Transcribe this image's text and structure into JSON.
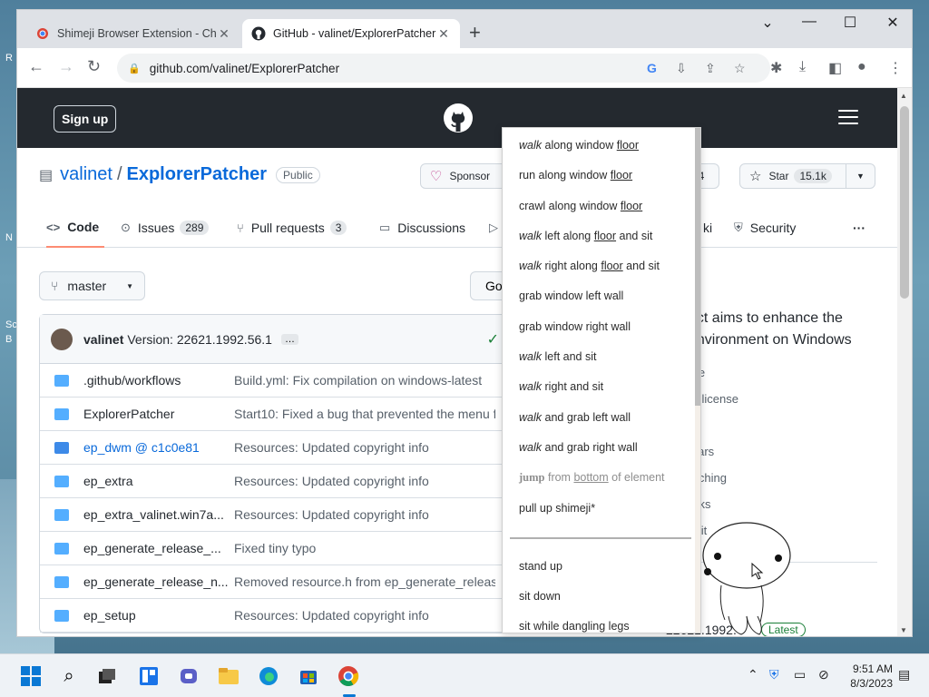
{
  "desktop": {
    "left_glyphs": [
      "R",
      "N",
      "Sc",
      "B"
    ]
  },
  "browser": {
    "tabs": [
      {
        "title": "Shimeji Browser Extension - Chro",
        "close": "✕",
        "active": false
      },
      {
        "title": "GitHub - valinet/ExplorerPatcher",
        "close": "✕",
        "active": true
      }
    ],
    "new_tab": "+",
    "window_controls": {
      "minimize": "—",
      "maximize": "☐",
      "close": "✕",
      "dropdown": "⌄"
    },
    "url": "github.com/valinet/ExplorerPatcher"
  },
  "github": {
    "sign_up": "Sign up",
    "repo": {
      "owner": "valinet",
      "separator": "/",
      "name": "ExplorerPatcher",
      "visibility": "Public"
    },
    "sponsor_label": "Sponsor",
    "watch_count_partial": "34",
    "star_label": "Star",
    "star_count": "15.1k",
    "tabs": [
      {
        "label": "Code",
        "icon": "code-icon"
      },
      {
        "label": "Issues",
        "count": "289",
        "icon": "issue-icon"
      },
      {
        "label": "Pull requests",
        "count": "3",
        "icon": "pull-request-icon"
      },
      {
        "label": "Discussions",
        "icon": "discussions-icon"
      },
      {
        "label": "ki",
        "icon": "wiki-icon"
      },
      {
        "label": "Security",
        "icon": "shield-icon"
      }
    ],
    "more": "···",
    "branch": "master",
    "goto_partial": "Go",
    "latest_commit": {
      "author": "valinet",
      "message": "Version: 22621.1992.56.1",
      "ellipsis": "…",
      "check": "✓"
    },
    "files": [
      {
        "name": ".github/workflows",
        "message": "Build.yml: Fix compilation on windows-latest",
        "submodule": false
      },
      {
        "name": "ExplorerPatcher",
        "message": "Start10: Fixed a bug that prevented the menu fr…",
        "submodule": false
      },
      {
        "name": "ep_dwm @ c1c0e81",
        "message": "Resources: Updated copyright info",
        "submodule": true
      },
      {
        "name": "ep_extra",
        "message": "Resources: Updated copyright info",
        "submodule": false
      },
      {
        "name": "ep_extra_valinet.win7a...",
        "message": "Resources: Updated copyright info",
        "submodule": false
      },
      {
        "name": "ep_generate_release_...",
        "message": "Fixed tiny typo",
        "submodule": false
      },
      {
        "name": "ep_generate_release_n...",
        "message": "Removed resource.h from ep_generate_release...",
        "submodule": false
      },
      {
        "name": "ep_setup",
        "message": "Resources: Updated copyright info",
        "submodule": false
      }
    ],
    "about": {
      "line1": "ect aims to enhance the",
      "line2": "environment on Windows",
      "list": [
        "me",
        ".0 license",
        "ty",
        "stars",
        "atching",
        "orks",
        "osit"
      ]
    },
    "release": {
      "version": "22621.1992.",
      "latest": "Latest"
    }
  },
  "context_menu": {
    "items": [
      {
        "verb": "walk",
        "rest": "along window",
        "u": "floor",
        "tail": ""
      },
      {
        "verb": "",
        "rest": "run along window",
        "u": "floor",
        "tail": ""
      },
      {
        "verb": "",
        "rest": "crawl along window",
        "u": "floor",
        "tail": ""
      },
      {
        "verb": "walk",
        "rest": "left along",
        "u": "floor",
        "tail": "and sit"
      },
      {
        "verb": "walk",
        "rest": "right along",
        "u": "floor",
        "tail": "and sit"
      },
      {
        "verb": "",
        "rest": "grab window left wall",
        "u": "",
        "tail": ""
      },
      {
        "verb": "",
        "rest": "grab window right wall",
        "u": "",
        "tail": ""
      },
      {
        "verb": "walk",
        "rest": "left and sit",
        "u": "",
        "tail": ""
      },
      {
        "verb": "walk",
        "rest": "right and sit",
        "u": "",
        "tail": ""
      },
      {
        "verb": "walk",
        "rest": "and grab left wall",
        "u": "",
        "tail": ""
      },
      {
        "verb": "walk",
        "rest": "and grab right wall",
        "u": "",
        "tail": ""
      }
    ],
    "jump": {
      "verb": "jump",
      "rest": "from",
      "u": "bottom",
      "tail": "of element"
    },
    "pull_up": "pull up shimeji*",
    "actions": [
      "stand up",
      "sit down",
      "sit while dangling legs"
    ]
  },
  "taskbar": {
    "apps": [
      "windows-start-icon",
      "search-icon",
      "task-view-icon",
      "widgets-icon",
      "teams-icon",
      "file-explorer-icon",
      "edge-icon",
      "store-icon",
      "chrome-icon"
    ],
    "time": "9:51 AM",
    "date": "8/3/2023"
  }
}
